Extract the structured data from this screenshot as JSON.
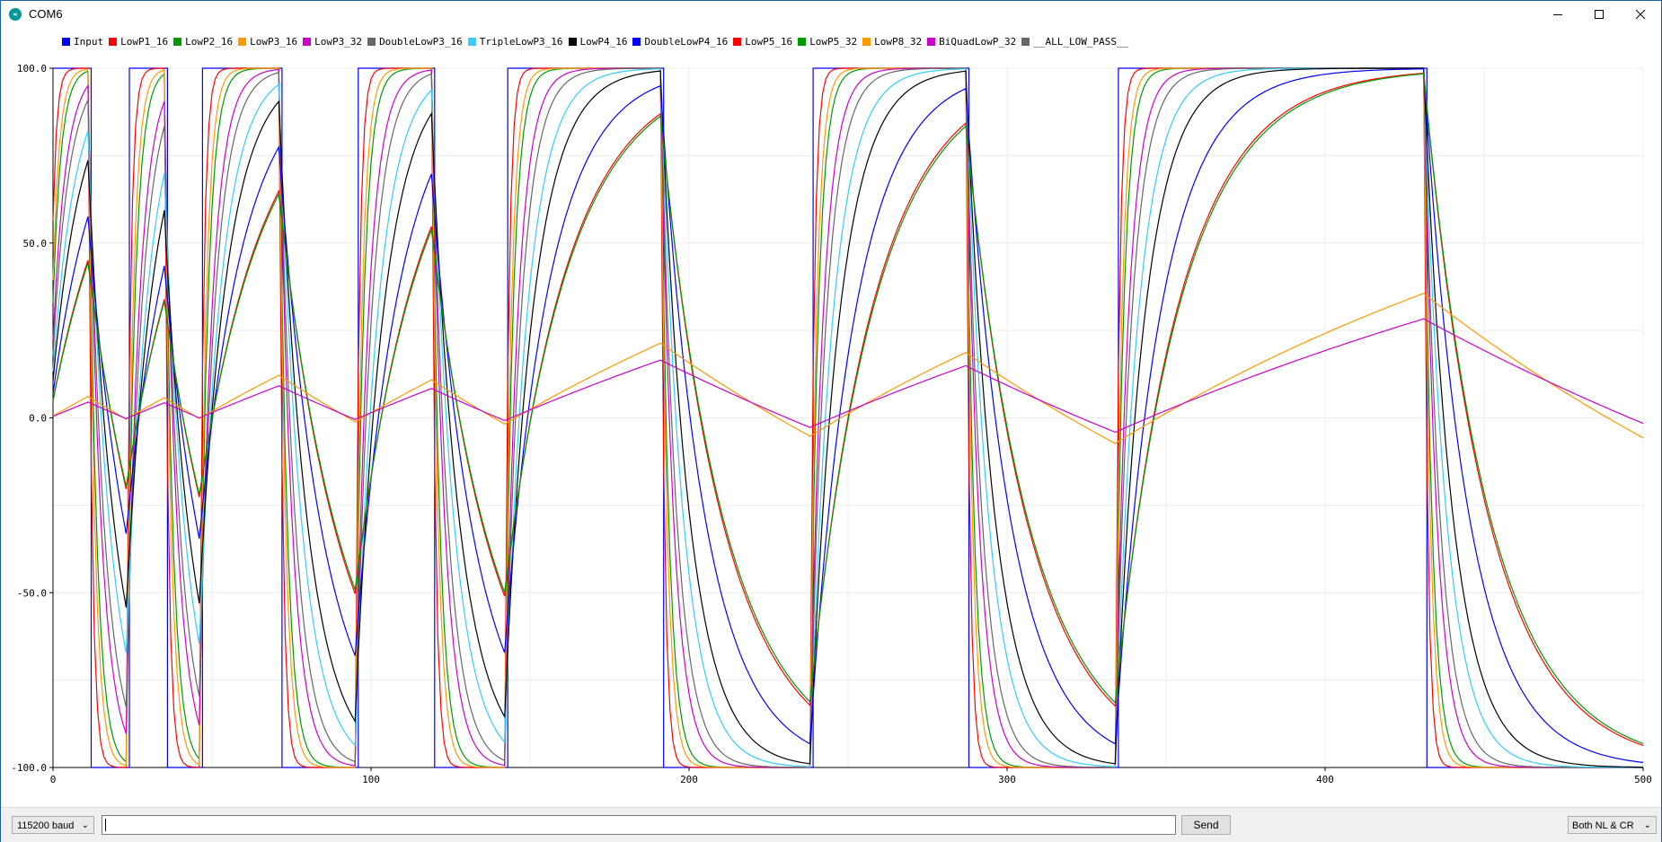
{
  "window": {
    "title": "COM6",
    "app_icon_text": "∞",
    "minimize_icon": "minimize-icon",
    "maximize_icon": "maximize-icon",
    "close_icon": "close-icon"
  },
  "chart_data": {
    "type": "line",
    "title": "",
    "xlabel": "",
    "ylabel": "",
    "xlim": [
      0,
      500
    ],
    "ylim": [
      -100,
      100
    ],
    "x_ticks": [
      "0",
      "100",
      "200",
      "300",
      "400",
      "500"
    ],
    "y_ticks": [
      "100.0",
      "50.0",
      "0.0",
      "-50.0",
      "-100.0"
    ],
    "grid": true,
    "legend_position": "top-left",
    "input_transitions": [
      0,
      12,
      24,
      36,
      47,
      72,
      96,
      120,
      143,
      192,
      239,
      288,
      335,
      432
    ],
    "series": [
      {
        "name": "Input",
        "color": "#0000ff",
        "tau": 0
      },
      {
        "name": "LowP1_16",
        "color": "#ff0000",
        "tau": 1.2
      },
      {
        "name": "LowP2_16",
        "color": "#009900",
        "tau": 2.5
      },
      {
        "name": "LowP3_16",
        "color": "#ff9900",
        "tau": 2.0
      },
      {
        "name": "LowP3_32",
        "color": "#cc00cc",
        "tau": 4.0
      },
      {
        "name": "DoubleLowP3_16",
        "color": "#666666",
        "tau": 5.0
      },
      {
        "name": "TripleLowP3_16",
        "color": "#33ccff",
        "tau": 7.0
      },
      {
        "name": "LowP4_16",
        "color": "#000000",
        "tau": 9.0
      },
      {
        "name": "DoubleLowP4_16",
        "color": "#0000ff",
        "tau": 14.0
      },
      {
        "name": "LowP5_16",
        "color": "#ff0000",
        "tau": 20.0
      },
      {
        "name": "LowP5_32",
        "color": "#009900",
        "tau": 20.5
      },
      {
        "name": "LowP8_32",
        "color": "#ff9900",
        "tau": 190.0
      },
      {
        "name": "BiQuadLowP_32",
        "color": "#cc00cc",
        "tau": 260.0
      },
      {
        "name": "__ALL_LOW_PASS__",
        "color": "#666666",
        "tau": 0
      }
    ]
  },
  "bottom": {
    "baud": "115200 baud",
    "input_value": "",
    "send": "Send",
    "line_ending": "Both NL & CR"
  }
}
